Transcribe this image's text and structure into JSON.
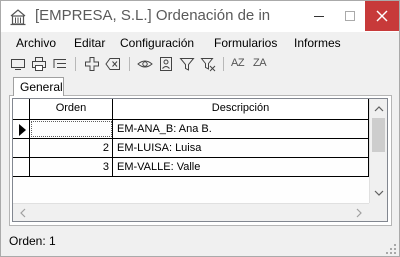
{
  "window": {
    "title": "[EMPRESA, S.L.] Ordenación de info..."
  },
  "menu": {
    "items": [
      {
        "label": "Archivo"
      },
      {
        "label": "Editar"
      },
      {
        "label": "Configuración"
      },
      {
        "label": "Formularios"
      },
      {
        "label": "Informes"
      }
    ]
  },
  "toolbar": {
    "icons": [
      "display-icon",
      "print-icon",
      "list-icon",
      "add-icon",
      "delete-icon",
      "view-icon",
      "user-card-icon",
      "filter-icon",
      "clear-filter-icon",
      "sort-ascending-icon",
      "sort-descending-icon"
    ],
    "sort_az_label": "AZ",
    "sort_za_label": "ZA"
  },
  "tabs": [
    {
      "label": "General",
      "active": true
    }
  ],
  "grid": {
    "columns": [
      "Orden",
      "Descripción"
    ],
    "rows": [
      {
        "orden": "",
        "descripcion": "EM-ANA_B: Ana B.",
        "current": true
      },
      {
        "orden": "2",
        "descripcion": "EM-LUISA: Luisa",
        "current": false
      },
      {
        "orden": "3",
        "descripcion": "EM-VALLE: Valle",
        "current": false
      }
    ]
  },
  "status": {
    "text": "Orden: 1"
  },
  "colors": {
    "close_button": "#c73a3a",
    "title_text": "#5a5a5a",
    "chrome": "#f0f0f0"
  }
}
